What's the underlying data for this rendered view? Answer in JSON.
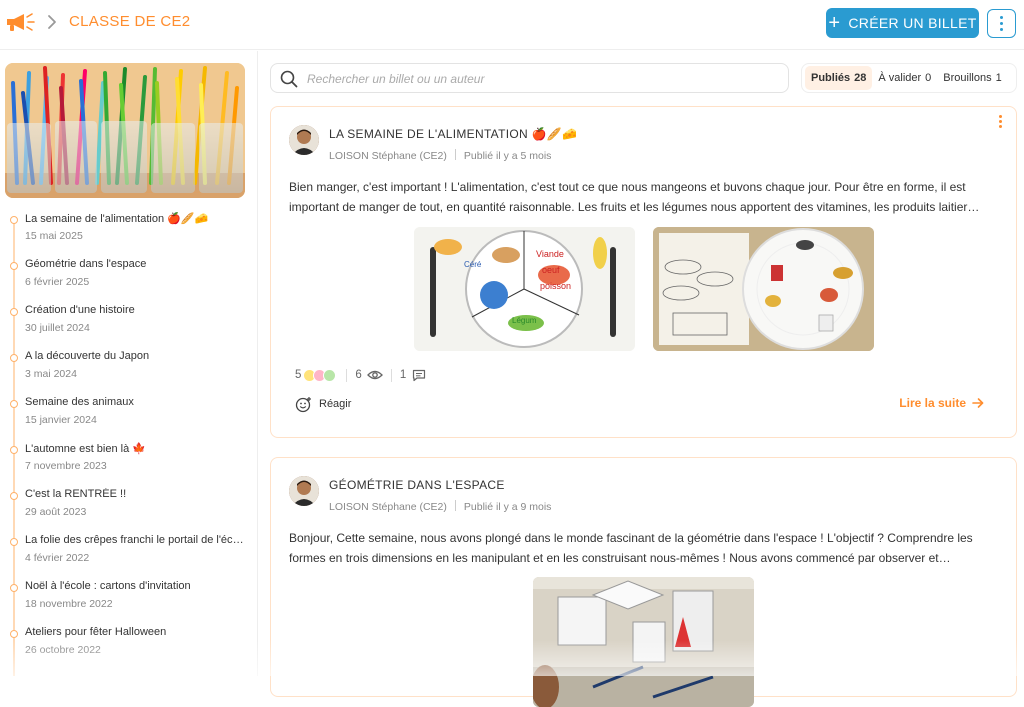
{
  "header": {
    "logo_icon": "megaphone-icon",
    "breadcrumb_icon": "chevron-right-icon",
    "class_title": "CLASSE DE CE2",
    "create_button_label": "CRÉER UN BILLET",
    "more_icon": "kebab-menu-icon",
    "accent_color": "#ff8d2e",
    "primary_color": "#2a9bd1"
  },
  "sidebar": {
    "items": [
      {
        "title": "La semaine de l'alimentation 🍎🥖🧀",
        "date": "15 mai 2025"
      },
      {
        "title": "Géométrie dans l'espace",
        "date": "6 février 2025"
      },
      {
        "title": "Création d'une histoire",
        "date": "30 juillet 2024"
      },
      {
        "title": "A la découverte du Japon",
        "date": "3 mai 2024"
      },
      {
        "title": "Semaine des animaux",
        "date": "15 janvier 2024"
      },
      {
        "title": "L'automne est bien là 🍁",
        "date": "7 novembre 2023"
      },
      {
        "title": "C'est la RENTRÉE !!",
        "date": "29 août 2023"
      },
      {
        "title": "La folie des crêpes franchi le portail de l'école…",
        "date": "4 février 2022"
      },
      {
        "title": "Noël à l'école : cartons d'invitation",
        "date": "18 novembre 2022"
      },
      {
        "title": "Ateliers pour fêter Halloween",
        "date": "26 octobre 2022"
      }
    ]
  },
  "search": {
    "placeholder": "Rechercher un billet ou un auteur",
    "value": ""
  },
  "filters": [
    {
      "label": "Publiés",
      "count": "28",
      "active": true
    },
    {
      "label": "À valider",
      "count": "0",
      "active": false
    },
    {
      "label": "Brouillons",
      "count": "1",
      "active": false
    }
  ],
  "posts": [
    {
      "title": "LA SEMAINE DE L'ALIMENTATION 🍎🥖🧀",
      "author": "LOISON Stéphane (CE2)",
      "published": "Publié il y a 5 mois",
      "excerpt": "Bien manger, c'est important ! L'alimentation, c'est tout ce que nous mangeons et buvons chaque jour. Pour être en forme, il est important de manger de tout, en quantité raisonnable. Les fruits et les légumes nous apportent des vitamines, les produits laitier…",
      "image_labels": [
        "Viande",
        "oeuf",
        "poisson",
        "Légum",
        "Céré"
      ],
      "reactions": "5",
      "views": "6",
      "comments": "1",
      "react_label": "Réagir",
      "read_more": "Lire la suite"
    },
    {
      "title": "GÉOMÉTRIE DANS L'ESPACE",
      "author": "LOISON Stéphane (CE2)",
      "published": "Publié il y a 9 mois",
      "excerpt": "Bonjour, Cette semaine, nous avons plongé dans le monde fascinant de la géométrie dans l'espace ! L'objectif ? Comprendre les formes en trois dimensions en les manipulant et en les construisant nous-mêmes ! Nous avons commencé par observer et…"
    }
  ]
}
